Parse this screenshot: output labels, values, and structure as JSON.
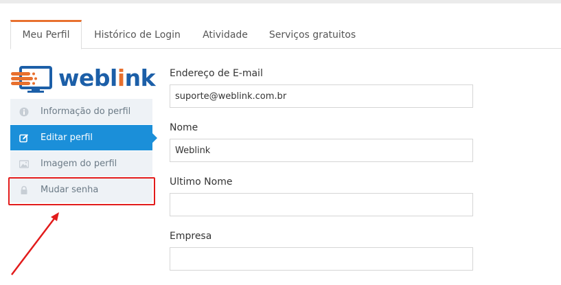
{
  "tabs": [
    {
      "label": "Meu Perfil",
      "active": true
    },
    {
      "label": "Histórico de Login",
      "active": false
    },
    {
      "label": "Atividade",
      "active": false
    },
    {
      "label": "Serviços gratuitos",
      "active": false
    }
  ],
  "logo": {
    "text_part1": "webl",
    "text_i": "i",
    "text_part2": "nk"
  },
  "side_menu": {
    "items": [
      {
        "label": "Informação do perfil",
        "icon": "info-icon"
      },
      {
        "label": "Editar perfil",
        "icon": "edit-icon",
        "active": true
      },
      {
        "label": "Imagem do perfil",
        "icon": "image-icon"
      },
      {
        "label": "Mudar senha",
        "icon": "lock-icon"
      }
    ]
  },
  "form": {
    "email": {
      "label": "Endereço de E-mail",
      "value": "suporte@weblink.com.br"
    },
    "nome": {
      "label": "Nome",
      "value": "Weblink"
    },
    "ultimo_nome": {
      "label": "Ultimo Nome",
      "value": ""
    },
    "empresa": {
      "label": "Empresa",
      "value": ""
    }
  },
  "colors": {
    "accent_orange": "#e8702e",
    "active_blue": "#1b8fd9",
    "highlight_red": "#e21b1b",
    "logo_blue": "#1c5fa8"
  }
}
